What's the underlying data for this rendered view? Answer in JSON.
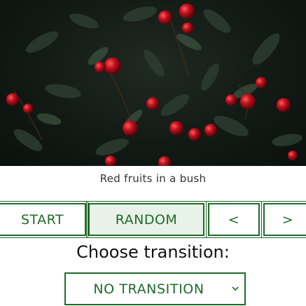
{
  "image": {
    "caption": "Red fruits in a bush"
  },
  "controls": {
    "start_label": "START",
    "random_label": "RANDOM",
    "prev_label": "<",
    "next_label": ">"
  },
  "transition": {
    "heading": "Choose transition:",
    "selected": "NO TRANSITION"
  },
  "colors": {
    "accent": "#1f6b2a",
    "berry": "#b3141f"
  }
}
